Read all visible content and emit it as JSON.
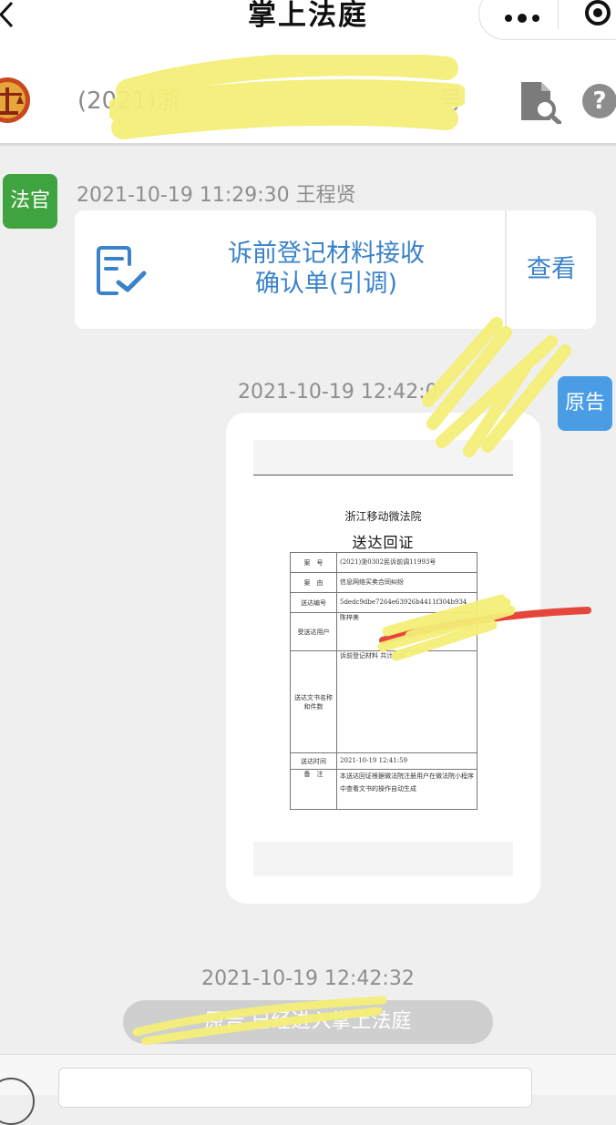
{
  "navbar": {
    "title": "掌上法庭"
  },
  "case": {
    "title_start": "(2021)浙",
    "title_end": "号"
  },
  "messages": {
    "judge": {
      "role": "法官",
      "timestamp": "2021-10-19 11:29:30 王程贤",
      "card_title_line1": "诉前登记材料接收",
      "card_title_line2": "确认单(引调)",
      "card_action": "查看"
    },
    "plaintiff": {
      "role": "原告",
      "timestamp": "2021-10-19 12:42:0",
      "receipt": {
        "court": "浙江移动微法院",
        "title": "送达回证",
        "rows": [
          {
            "label": "案　号",
            "value": "(2021)浙0302民诉前调11993号"
          },
          {
            "label": "案　由",
            "value": "信息网络买卖合同纠纷"
          },
          {
            "label": "送达编号",
            "value": "5dedc9dbe7264e63926b4411f304b934"
          },
          {
            "label": "受送达用户",
            "value": "陈梓美"
          },
          {
            "label": "送达文书名称和件数",
            "value": "诉前登记材料 共计:1件"
          },
          {
            "label": "送达时间",
            "value": "2021-10-19 12:41:59"
          },
          {
            "label": "备　注",
            "value": "本送达回证根据微法院注册用户在微法院小程序中查看文书的操作自动生成"
          }
        ]
      }
    },
    "system": {
      "timestamp": "2021-10-19 12:42:32",
      "text": "原告 已经进入掌上法庭"
    }
  },
  "input": {
    "placeholder": ""
  }
}
